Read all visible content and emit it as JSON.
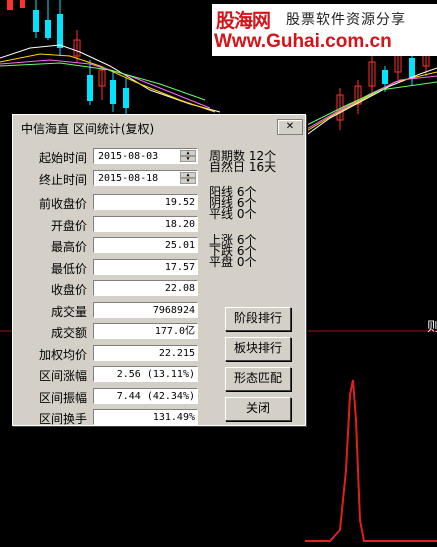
{
  "watermark": {
    "logo": "股海网",
    "slogan": "股票软件资源分享",
    "url": "Www.Guhai.com.cn"
  },
  "edge_char": "则",
  "dialog": {
    "title": "中信海直 区间统计(复权)",
    "close_label": "✕",
    "start_date_label": "起始时间",
    "start_date": "2015-08-03",
    "end_date_label": "终止时间",
    "end_date": "2015-08-18",
    "stats": [
      {
        "label": "前收盘价",
        "value": "19.52"
      },
      {
        "label": "开盘价",
        "value": "18.20"
      },
      {
        "label": "最高价",
        "value": "25.01"
      },
      {
        "label": "最低价",
        "value": "17.57"
      },
      {
        "label": "收盘价",
        "value": "22.08"
      },
      {
        "label": "成交量",
        "value": "7968924"
      },
      {
        "label": "成交额",
        "value": "177.0亿"
      },
      {
        "label": "加权均价",
        "value": "22.215"
      },
      {
        "label": "区间涨幅",
        "value": "2.56 (13.11%)"
      },
      {
        "label": "区间振幅",
        "value": "7.44 (42.34%)"
      },
      {
        "label": "区间换手",
        "value": "131.49%"
      }
    ],
    "period": {
      "periods_label": "周期数",
      "periods_value": "12个",
      "natural_label": "自然日",
      "natural_value": "16天"
    },
    "yin_yang": {
      "yang_label": "阳线",
      "yang_value": "6个",
      "yin_label": "阴线",
      "yin_value": "6个",
      "flat_label": "平线",
      "flat_value": "0个"
    },
    "up_down": {
      "up_label": "上涨",
      "up_value": "6个",
      "down_label": "下跌",
      "down_value": "6个",
      "flat_label": "平盘",
      "flat_value": "0个"
    },
    "buttons": {
      "stage_rank": "阶段排行",
      "sector_rank": "板块排行",
      "pattern_match": "形态匹配",
      "close": "关闭"
    }
  },
  "colors": {
    "dialog_bg": "#d4d0c8",
    "up_candle": "#00e5ff",
    "down_candle": "#ff3b3b",
    "volume_line": "#e02020",
    "brand_red": "#d5141a"
  }
}
